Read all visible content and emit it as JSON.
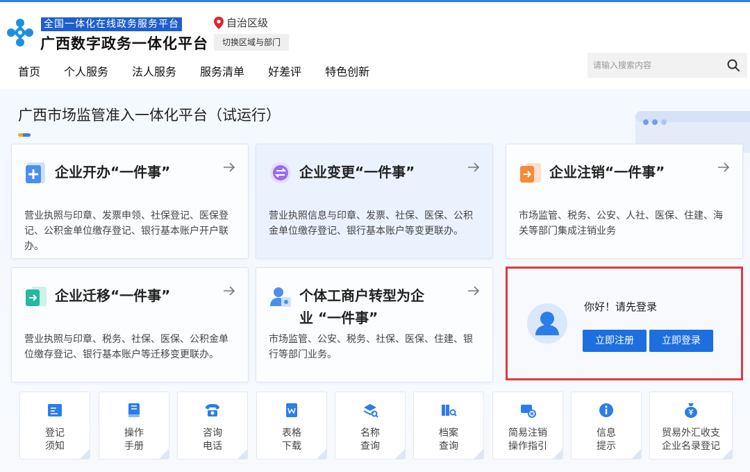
{
  "header": {
    "tagline": "全国一体化在线政务服务平台",
    "brand": "广西数字政务一体化平台",
    "region": "自治区级",
    "switch_label": "切换区域与部门",
    "search_placeholder": "请输入搜索内容"
  },
  "nav": [
    "首页",
    "个人服务",
    "法人服务",
    "服务清单",
    "好差评",
    "特色创新"
  ],
  "main": {
    "title": "广西市场监管准入一体化平台（试运行）",
    "cards": [
      {
        "title": "企业开办“一件事”",
        "desc_lines": [
          "营业执照与印章、发票申领、社保登记、医保登",
          "记、公积金单位缴存登记、银行基本账户开户联",
          "办。"
        ]
      },
      {
        "title": "企业变更“一件事”",
        "desc_lines": [
          "营业执照信息与印章、发票、社保、医保、公积",
          "金单位缴存登记、银行基本账户等变更联办。"
        ]
      },
      {
        "title": "企业注销“一件事”",
        "desc_lines": [
          "市场监管、税务、公安、人社、医保、住建、海",
          "关等部门集成注销业务"
        ]
      },
      {
        "title": "企业迁移“一件事”",
        "desc_lines": [
          "营业执照与印章、税务、社保、医保、公积金单",
          "位缴存登记、银行基本账户等迁移变更联办。"
        ]
      },
      {
        "title_lines": [
          "个体工商户转型为企",
          "业 “一件事”"
        ],
        "desc_lines": [
          "市场监管、公安、税务、社保、医保、住建、银",
          "行等部门业务。"
        ]
      }
    ],
    "login": {
      "greeting": "你好！请先登录",
      "register": "立即注册",
      "login": "立即登录"
    }
  },
  "tools": [
    {
      "l1": "登记",
      "l2": "须知",
      "icon": "register-notice-icon"
    },
    {
      "l1": "操作",
      "l2": "手册",
      "icon": "manual-icon"
    },
    {
      "l1": "咨询",
      "l2": "电话",
      "icon": "phone-icon"
    },
    {
      "l1": "表格",
      "l2": "下载",
      "icon": "word-doc-icon"
    },
    {
      "l1": "名称",
      "l2": "查询",
      "icon": "name-query-icon"
    },
    {
      "l1": "档案",
      "l2": "查询",
      "icon": "archive-icon"
    },
    {
      "l1": "简易注销",
      "l2": "操作指引",
      "icon": "simple-cancel-icon"
    },
    {
      "l1": "信息",
      "l2": "提示",
      "icon": "info-icon"
    },
    {
      "l1": "贸易外汇收支",
      "l2": "企业名录登记",
      "icon": "money-bag-icon"
    }
  ],
  "colors": {
    "accent": "#1d6fe0",
    "highlight_border": "#e0383e",
    "brand_blue": "#1e5fcf"
  }
}
